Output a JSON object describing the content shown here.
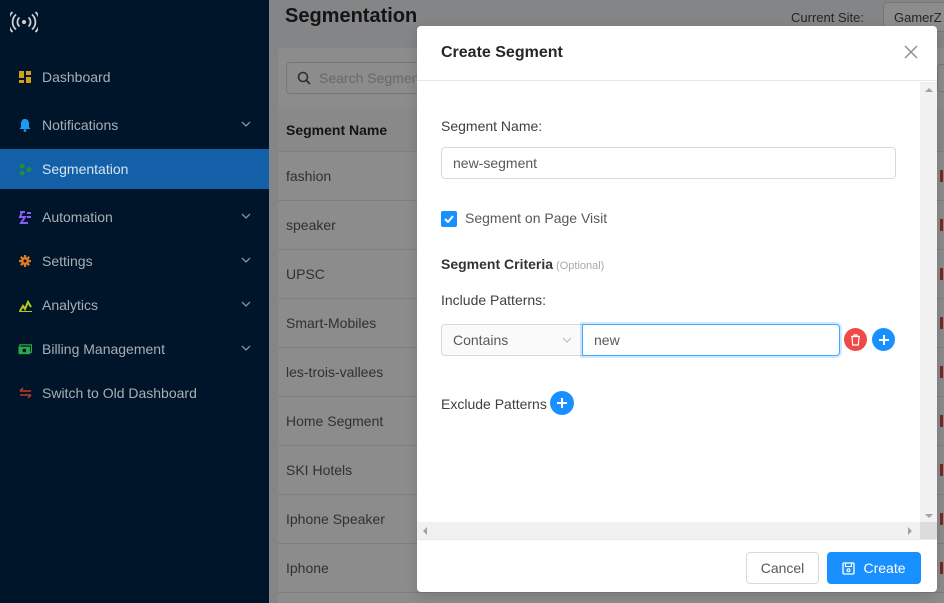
{
  "sidebar": {
    "logo_icon": "broadcast-icon",
    "items": [
      {
        "label": "Dashboard",
        "icon": "dashboard-icon",
        "icon_color": "#d4a017",
        "expandable": false,
        "active": false
      },
      {
        "label": "Notifications",
        "icon": "bell-icon",
        "icon_color": "#1d9bf0",
        "expandable": true,
        "active": false
      },
      {
        "label": "Segmentation",
        "icon": "segmentation-icon",
        "icon_color": "#1f8f3a",
        "expandable": false,
        "active": true
      },
      {
        "label": "Automation",
        "icon": "automation-icon",
        "icon_color": "#8a5cf5",
        "expandable": true,
        "active": false
      },
      {
        "label": "Settings",
        "icon": "gear-icon",
        "icon_color": "#e07b24",
        "expandable": true,
        "active": false
      },
      {
        "label": "Analytics",
        "icon": "analytics-icon",
        "icon_color": "#b5c91b",
        "expandable": true,
        "active": false
      },
      {
        "label": "Billing Management",
        "icon": "billing-icon",
        "icon_color": "#2aa84a",
        "expandable": true,
        "active": false
      },
      {
        "label": "Switch to Old Dashboard",
        "icon": "switch-icon",
        "icon_color": "#c0392b",
        "expandable": false,
        "active": false
      }
    ]
  },
  "page": {
    "title": "Segmentation",
    "current_site_label": "Current Site:",
    "current_site_value": "GamerZ",
    "search_placeholder": "Search Segments",
    "table": {
      "column_header": "Segment Name",
      "rows": [
        "fashion",
        "speaker",
        "UPSC",
        "Smart-Mobiles",
        "les-trois-vallees",
        "Home Segment",
        "SKI Hotels",
        "Iphone Speaker",
        "Iphone"
      ]
    }
  },
  "modal": {
    "title": "Create Segment",
    "segment_name_label": "Segment Name:",
    "segment_name_value": "new-segment",
    "page_visit_label": "Segment on Page Visit",
    "page_visit_checked": true,
    "criteria_label": "Segment Criteria",
    "criteria_optional": "(Optional)",
    "include_label": "Include Patterns:",
    "include_patterns": [
      {
        "match_type": "Contains",
        "value": "new"
      }
    ],
    "exclude_label": "Exclude Patterns",
    "cancel_label": "Cancel",
    "create_label": "Create"
  },
  "colors": {
    "primary": "#1890ff",
    "danger": "#ef4a4a",
    "sidebar_bg": "#001529",
    "sidebar_active": "#1460a8"
  }
}
